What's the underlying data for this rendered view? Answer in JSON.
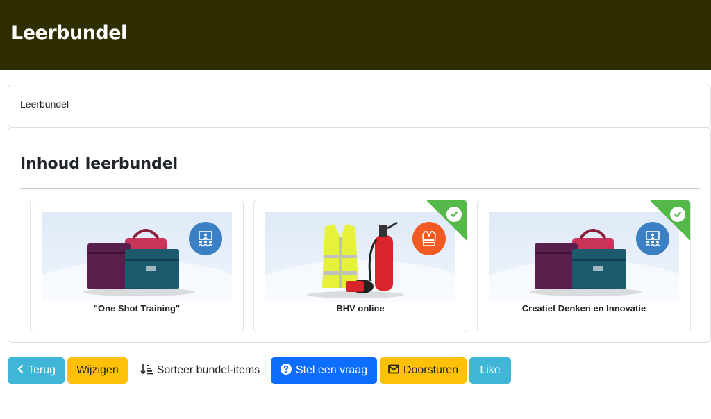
{
  "header": {
    "title": "Leerbundel"
  },
  "breadcrumb": {
    "current": "Leerbundel"
  },
  "content": {
    "heading": "Inhoud leerbundel",
    "items": [
      {
        "title": "\"One Shot Training\"",
        "type_icon": "classroom-icon",
        "completed": false
      },
      {
        "title": "BHV online",
        "type_icon": "safety-vest-icon",
        "completed": true
      },
      {
        "title": "Creatief Denken en Innovatie",
        "type_icon": "classroom-icon",
        "completed": true
      }
    ]
  },
  "actions": {
    "back_label": "Terug",
    "edit_label": "Wijzigen",
    "sort_label": "Sorteer bundel-items",
    "ask_label": "Stel een vraag",
    "forward_label": "Doorsturen",
    "like_label": "Like"
  },
  "colors": {
    "header_bg": "#2e2e00",
    "info": "#3fb6d6",
    "warning": "#ffc107",
    "primary": "#0d6efd",
    "completed": "#55b94a"
  }
}
